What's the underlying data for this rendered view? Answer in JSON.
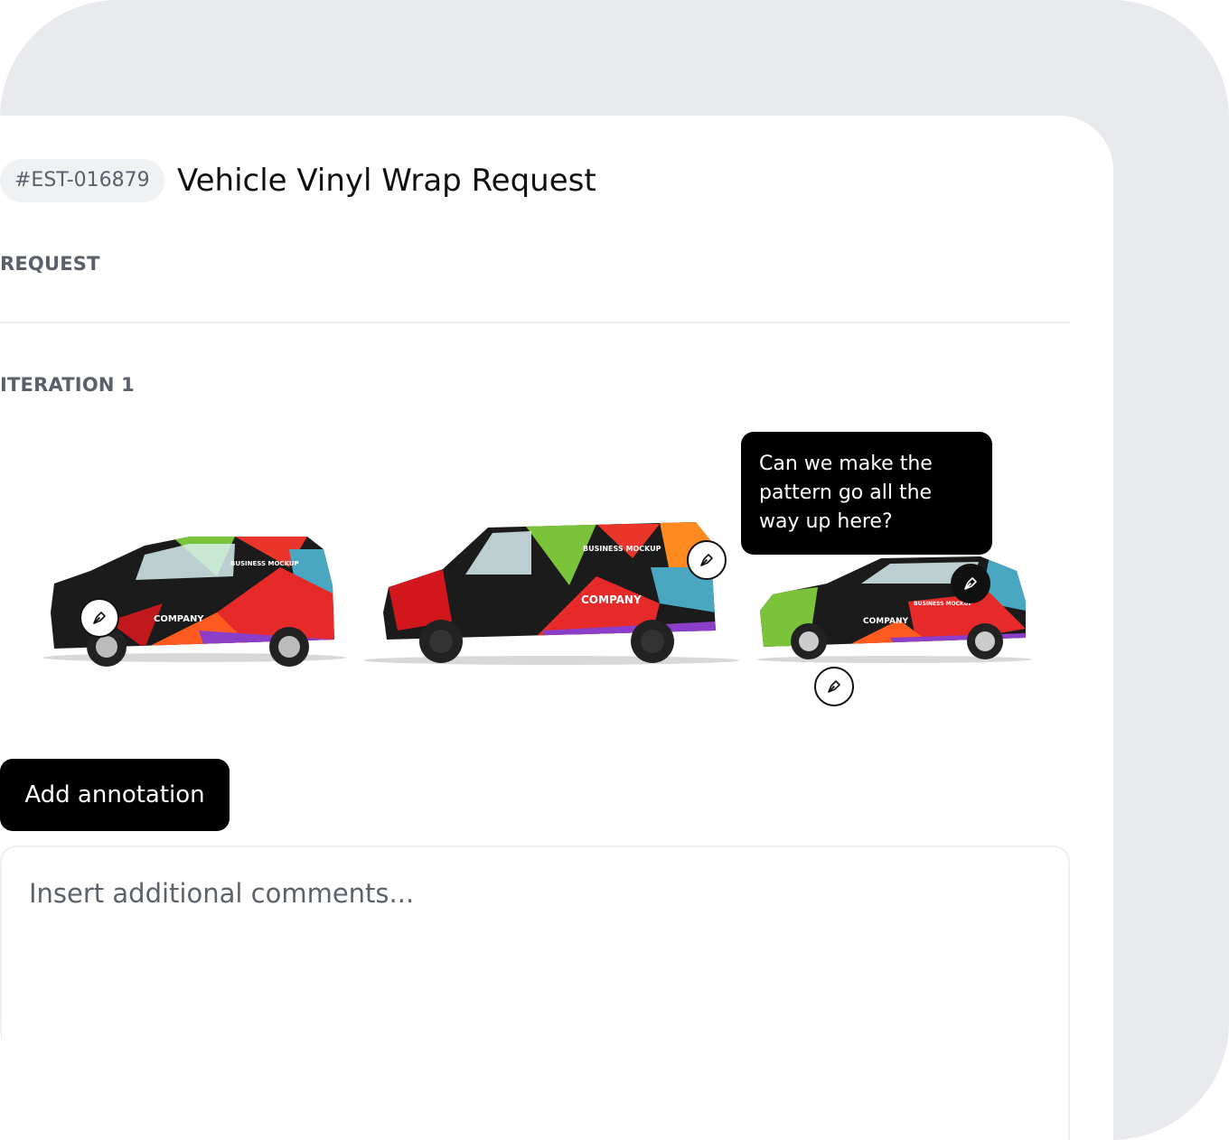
{
  "request": {
    "id": "#EST-016879",
    "title": "Vehicle Vinyl Wrap Request",
    "section_request": "REQUEST",
    "section_iteration": "ITERATION 1"
  },
  "vehicles": [
    {
      "name": "compact-van",
      "company_text": "COMPANY",
      "mockup_text": "BUSINESS MOCKUP"
    },
    {
      "name": "cargo-van",
      "company_text": "COMPANY",
      "mockup_text": "BUSINESS MOCKUP"
    },
    {
      "name": "hatchback",
      "company_text": "COMPANY",
      "mockup_text": "BUSINESS MOCKUP"
    }
  ],
  "annotation_tooltip": "Can we make the pattern go all the way up here?",
  "actions": {
    "add_annotation": "Add annotation"
  },
  "comments": {
    "placeholder": "Insert additional comments..."
  },
  "icons": {
    "annotation_pin": "pen-nib-icon"
  },
  "colors": {
    "background": "#e9eaed",
    "panel": "#ffffff",
    "button": "#000000",
    "label": "#5a5f6a"
  }
}
